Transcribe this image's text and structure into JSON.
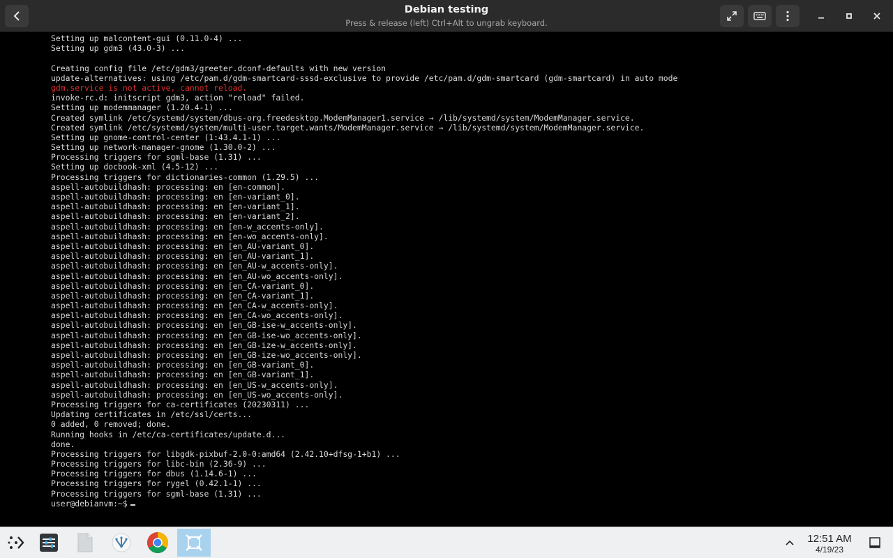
{
  "window": {
    "title": "Debian testing",
    "subtitle": "Press & release (left) Ctrl+Alt to ungrab keyboard."
  },
  "terminal": {
    "lines": [
      {
        "text": "Setting up malcontent-gui (0.11.0-4) ...",
        "error": false
      },
      {
        "text": "Setting up gdm3 (43.0-3) ...",
        "error": false
      },
      {
        "text": "",
        "error": false
      },
      {
        "text": "Creating config file /etc/gdm3/greeter.dconf-defaults with new version",
        "error": false
      },
      {
        "text": "update-alternatives: using /etc/pam.d/gdm-smartcard-sssd-exclusive to provide /etc/pam.d/gdm-smartcard (gdm-smartcard) in auto mode",
        "error": false
      },
      {
        "text": "gdm.service is not active, cannot reload.",
        "error": true
      },
      {
        "text": "invoke-rc.d: initscript gdm3, action \"reload\" failed.",
        "error": false
      },
      {
        "text": "Setting up modemmanager (1.20.4-1) ...",
        "error": false
      },
      {
        "text": "Created symlink /etc/systemd/system/dbus-org.freedesktop.ModemManager1.service → /lib/systemd/system/ModemManager.service.",
        "error": false
      },
      {
        "text": "Created symlink /etc/systemd/system/multi-user.target.wants/ModemManager.service → /lib/systemd/system/ModemManager.service.",
        "error": false
      },
      {
        "text": "Setting up gnome-control-center (1:43.4.1-1) ...",
        "error": false
      },
      {
        "text": "Setting up network-manager-gnome (1.30.0-2) ...",
        "error": false
      },
      {
        "text": "Processing triggers for sgml-base (1.31) ...",
        "error": false
      },
      {
        "text": "Setting up docbook-xml (4.5-12) ...",
        "error": false
      },
      {
        "text": "Processing triggers for dictionaries-common (1.29.5) ...",
        "error": false
      },
      {
        "text": "aspell-autobuildhash: processing: en [en-common].",
        "error": false
      },
      {
        "text": "aspell-autobuildhash: processing: en [en-variant_0].",
        "error": false
      },
      {
        "text": "aspell-autobuildhash: processing: en [en-variant_1].",
        "error": false
      },
      {
        "text": "aspell-autobuildhash: processing: en [en-variant_2].",
        "error": false
      },
      {
        "text": "aspell-autobuildhash: processing: en [en-w_accents-only].",
        "error": false
      },
      {
        "text": "aspell-autobuildhash: processing: en [en-wo_accents-only].",
        "error": false
      },
      {
        "text": "aspell-autobuildhash: processing: en [en_AU-variant_0].",
        "error": false
      },
      {
        "text": "aspell-autobuildhash: processing: en [en_AU-variant_1].",
        "error": false
      },
      {
        "text": "aspell-autobuildhash: processing: en [en_AU-w_accents-only].",
        "error": false
      },
      {
        "text": "aspell-autobuildhash: processing: en [en_AU-wo_accents-only].",
        "error": false
      },
      {
        "text": "aspell-autobuildhash: processing: en [en_CA-variant_0].",
        "error": false
      },
      {
        "text": "aspell-autobuildhash: processing: en [en_CA-variant_1].",
        "error": false
      },
      {
        "text": "aspell-autobuildhash: processing: en [en_CA-w_accents-only].",
        "error": false
      },
      {
        "text": "aspell-autobuildhash: processing: en [en_CA-wo_accents-only].",
        "error": false
      },
      {
        "text": "aspell-autobuildhash: processing: en [en_GB-ise-w_accents-only].",
        "error": false
      },
      {
        "text": "aspell-autobuildhash: processing: en [en_GB-ise-wo_accents-only].",
        "error": false
      },
      {
        "text": "aspell-autobuildhash: processing: en [en_GB-ize-w_accents-only].",
        "error": false
      },
      {
        "text": "aspell-autobuildhash: processing: en [en_GB-ize-wo_accents-only].",
        "error": false
      },
      {
        "text": "aspell-autobuildhash: processing: en [en_GB-variant_0].",
        "error": false
      },
      {
        "text": "aspell-autobuildhash: processing: en [en_GB-variant_1].",
        "error": false
      },
      {
        "text": "aspell-autobuildhash: processing: en [en_US-w_accents-only].",
        "error": false
      },
      {
        "text": "aspell-autobuildhash: processing: en [en_US-wo_accents-only].",
        "error": false
      },
      {
        "text": "Processing triggers for ca-certificates (20230311) ...",
        "error": false
      },
      {
        "text": "Updating certificates in /etc/ssl/certs...",
        "error": false
      },
      {
        "text": "0 added, 0 removed; done.",
        "error": false
      },
      {
        "text": "Running hooks in /etc/ca-certificates/update.d...",
        "error": false
      },
      {
        "text": "done.",
        "error": false
      },
      {
        "text": "Processing triggers for libgdk-pixbuf-2.0-0:amd64 (2.42.10+dfsg-1+b1) ...",
        "error": false
      },
      {
        "text": "Processing triggers for libc-bin (2.36-9) ...",
        "error": false
      },
      {
        "text": "Processing triggers for dbus (1.14.6-1) ...",
        "error": false
      },
      {
        "text": "Processing triggers for rygel (0.42.1-1) ...",
        "error": false
      },
      {
        "text": "Processing triggers for sgml-base (1.31) ...",
        "error": false
      }
    ],
    "prompt": "user@debianvm:~$"
  },
  "taskbar": {
    "clock_time": "12:51 AM",
    "clock_date": "4/19/23",
    "apps": [
      {
        "name": "app-launcher-icon",
        "active": false
      },
      {
        "name": "system-settings-icon",
        "active": false
      },
      {
        "name": "files-icon",
        "active": false
      },
      {
        "name": "discover-icon",
        "active": false
      },
      {
        "name": "chrome-icon",
        "active": false
      },
      {
        "name": "vm-display-icon",
        "active": true
      }
    ]
  },
  "colors": {
    "terminal_bg": "#000000",
    "terminal_fg": "#d9d9d9",
    "error_fg": "#e03030",
    "header_bg": "#2b2b2b",
    "taskbar_bg": "#eef0f1",
    "active_task": "#a9d2ef"
  }
}
